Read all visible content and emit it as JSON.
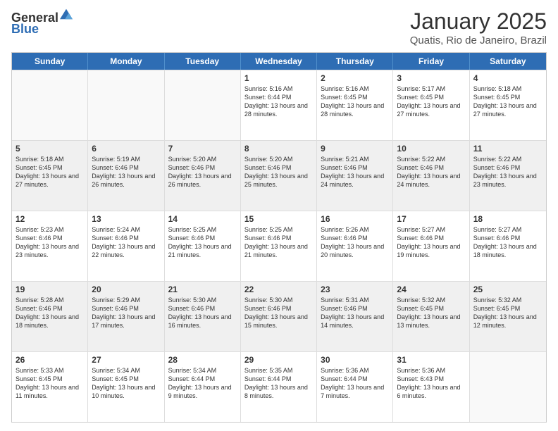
{
  "logo": {
    "general": "General",
    "blue": "Blue"
  },
  "header": {
    "title": "January 2025",
    "subtitle": "Quatis, Rio de Janeiro, Brazil"
  },
  "weekdays": [
    "Sunday",
    "Monday",
    "Tuesday",
    "Wednesday",
    "Thursday",
    "Friday",
    "Saturday"
  ],
  "weeks": [
    [
      {
        "day": "",
        "sunrise": "",
        "sunset": "",
        "daylight": "",
        "empty": true
      },
      {
        "day": "",
        "sunrise": "",
        "sunset": "",
        "daylight": "",
        "empty": true
      },
      {
        "day": "",
        "sunrise": "",
        "sunset": "",
        "daylight": "",
        "empty": true
      },
      {
        "day": "1",
        "sunrise": "Sunrise: 5:16 AM",
        "sunset": "Sunset: 6:44 PM",
        "daylight": "Daylight: 13 hours and 28 minutes."
      },
      {
        "day": "2",
        "sunrise": "Sunrise: 5:16 AM",
        "sunset": "Sunset: 6:45 PM",
        "daylight": "Daylight: 13 hours and 28 minutes."
      },
      {
        "day": "3",
        "sunrise": "Sunrise: 5:17 AM",
        "sunset": "Sunset: 6:45 PM",
        "daylight": "Daylight: 13 hours and 27 minutes."
      },
      {
        "day": "4",
        "sunrise": "Sunrise: 5:18 AM",
        "sunset": "Sunset: 6:45 PM",
        "daylight": "Daylight: 13 hours and 27 minutes."
      }
    ],
    [
      {
        "day": "5",
        "sunrise": "Sunrise: 5:18 AM",
        "sunset": "Sunset: 6:45 PM",
        "daylight": "Daylight: 13 hours and 27 minutes."
      },
      {
        "day": "6",
        "sunrise": "Sunrise: 5:19 AM",
        "sunset": "Sunset: 6:46 PM",
        "daylight": "Daylight: 13 hours and 26 minutes."
      },
      {
        "day": "7",
        "sunrise": "Sunrise: 5:20 AM",
        "sunset": "Sunset: 6:46 PM",
        "daylight": "Daylight: 13 hours and 26 minutes."
      },
      {
        "day": "8",
        "sunrise": "Sunrise: 5:20 AM",
        "sunset": "Sunset: 6:46 PM",
        "daylight": "Daylight: 13 hours and 25 minutes."
      },
      {
        "day": "9",
        "sunrise": "Sunrise: 5:21 AM",
        "sunset": "Sunset: 6:46 PM",
        "daylight": "Daylight: 13 hours and 24 minutes."
      },
      {
        "day": "10",
        "sunrise": "Sunrise: 5:22 AM",
        "sunset": "Sunset: 6:46 PM",
        "daylight": "Daylight: 13 hours and 24 minutes."
      },
      {
        "day": "11",
        "sunrise": "Sunrise: 5:22 AM",
        "sunset": "Sunset: 6:46 PM",
        "daylight": "Daylight: 13 hours and 23 minutes."
      }
    ],
    [
      {
        "day": "12",
        "sunrise": "Sunrise: 5:23 AM",
        "sunset": "Sunset: 6:46 PM",
        "daylight": "Daylight: 13 hours and 23 minutes."
      },
      {
        "day": "13",
        "sunrise": "Sunrise: 5:24 AM",
        "sunset": "Sunset: 6:46 PM",
        "daylight": "Daylight: 13 hours and 22 minutes."
      },
      {
        "day": "14",
        "sunrise": "Sunrise: 5:25 AM",
        "sunset": "Sunset: 6:46 PM",
        "daylight": "Daylight: 13 hours and 21 minutes."
      },
      {
        "day": "15",
        "sunrise": "Sunrise: 5:25 AM",
        "sunset": "Sunset: 6:46 PM",
        "daylight": "Daylight: 13 hours and 21 minutes."
      },
      {
        "day": "16",
        "sunrise": "Sunrise: 5:26 AM",
        "sunset": "Sunset: 6:46 PM",
        "daylight": "Daylight: 13 hours and 20 minutes."
      },
      {
        "day": "17",
        "sunrise": "Sunrise: 5:27 AM",
        "sunset": "Sunset: 6:46 PM",
        "daylight": "Daylight: 13 hours and 19 minutes."
      },
      {
        "day": "18",
        "sunrise": "Sunrise: 5:27 AM",
        "sunset": "Sunset: 6:46 PM",
        "daylight": "Daylight: 13 hours and 18 minutes."
      }
    ],
    [
      {
        "day": "19",
        "sunrise": "Sunrise: 5:28 AM",
        "sunset": "Sunset: 6:46 PM",
        "daylight": "Daylight: 13 hours and 18 minutes."
      },
      {
        "day": "20",
        "sunrise": "Sunrise: 5:29 AM",
        "sunset": "Sunset: 6:46 PM",
        "daylight": "Daylight: 13 hours and 17 minutes."
      },
      {
        "day": "21",
        "sunrise": "Sunrise: 5:30 AM",
        "sunset": "Sunset: 6:46 PM",
        "daylight": "Daylight: 13 hours and 16 minutes."
      },
      {
        "day": "22",
        "sunrise": "Sunrise: 5:30 AM",
        "sunset": "Sunset: 6:46 PM",
        "daylight": "Daylight: 13 hours and 15 minutes."
      },
      {
        "day": "23",
        "sunrise": "Sunrise: 5:31 AM",
        "sunset": "Sunset: 6:46 PM",
        "daylight": "Daylight: 13 hours and 14 minutes."
      },
      {
        "day": "24",
        "sunrise": "Sunrise: 5:32 AM",
        "sunset": "Sunset: 6:45 PM",
        "daylight": "Daylight: 13 hours and 13 minutes."
      },
      {
        "day": "25",
        "sunrise": "Sunrise: 5:32 AM",
        "sunset": "Sunset: 6:45 PM",
        "daylight": "Daylight: 13 hours and 12 minutes."
      }
    ],
    [
      {
        "day": "26",
        "sunrise": "Sunrise: 5:33 AM",
        "sunset": "Sunset: 6:45 PM",
        "daylight": "Daylight: 13 hours and 11 minutes."
      },
      {
        "day": "27",
        "sunrise": "Sunrise: 5:34 AM",
        "sunset": "Sunset: 6:45 PM",
        "daylight": "Daylight: 13 hours and 10 minutes."
      },
      {
        "day": "28",
        "sunrise": "Sunrise: 5:34 AM",
        "sunset": "Sunset: 6:44 PM",
        "daylight": "Daylight: 13 hours and 9 minutes."
      },
      {
        "day": "29",
        "sunrise": "Sunrise: 5:35 AM",
        "sunset": "Sunset: 6:44 PM",
        "daylight": "Daylight: 13 hours and 8 minutes."
      },
      {
        "day": "30",
        "sunrise": "Sunrise: 5:36 AM",
        "sunset": "Sunset: 6:44 PM",
        "daylight": "Daylight: 13 hours and 7 minutes."
      },
      {
        "day": "31",
        "sunrise": "Sunrise: 5:36 AM",
        "sunset": "Sunset: 6:43 PM",
        "daylight": "Daylight: 13 hours and 6 minutes."
      },
      {
        "day": "",
        "sunrise": "",
        "sunset": "",
        "daylight": "",
        "empty": true
      }
    ]
  ]
}
